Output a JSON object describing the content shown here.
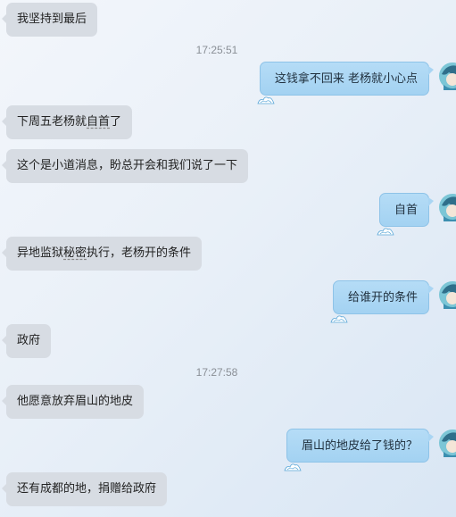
{
  "chat": {
    "messages": [
      {
        "type": "text",
        "direction": "incoming",
        "text": "我坚持到最后"
      },
      {
        "type": "timestamp",
        "text": "17:25:51"
      },
      {
        "type": "text",
        "direction": "outgoing",
        "text": "这钱拿不回来 老杨就小心点"
      },
      {
        "type": "text",
        "direction": "incoming",
        "text": "下周五老杨就自首了",
        "underlined": "自首"
      },
      {
        "type": "text",
        "direction": "incoming",
        "text": "这个是小道消息，盼总开会和我们说了一下"
      },
      {
        "type": "text",
        "direction": "outgoing",
        "text": "自首"
      },
      {
        "type": "text",
        "direction": "incoming",
        "text": "异地监狱秘密执行，老杨开的条件",
        "underlined": "秘密"
      },
      {
        "type": "text",
        "direction": "outgoing",
        "text": "给谁开的条件"
      },
      {
        "type": "text",
        "direction": "incoming",
        "text": "政府"
      },
      {
        "type": "timestamp",
        "text": "17:27:58"
      },
      {
        "type": "text",
        "direction": "incoming",
        "text": "他愿意放弃眉山的地皮"
      },
      {
        "type": "text",
        "direction": "outgoing",
        "text": "眉山的地皮给了钱的？"
      },
      {
        "type": "text",
        "direction": "incoming",
        "text": "还有成都的地，捐赠给政府"
      }
    ]
  },
  "colors": {
    "incoming_bubble": "#d7dce3",
    "outgoing_bubble": "#a9d5f3",
    "timestamp_text": "#8a8f96"
  },
  "icons": {
    "outgoing_avatar": "avatar-icon",
    "bubble_decoration": "wave-icon"
  }
}
